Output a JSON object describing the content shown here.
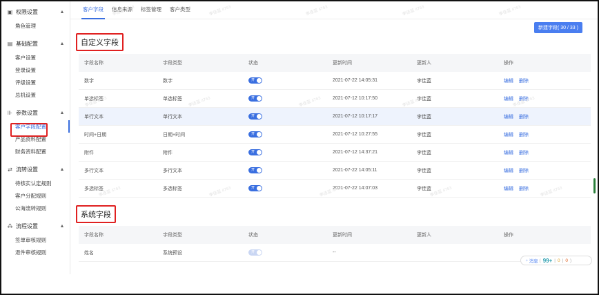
{
  "sidebar": {
    "groups": [
      {
        "icon": "shield-icon",
        "label": "权限设置",
        "items": [
          "角色管理"
        ]
      },
      {
        "icon": "doc-icon",
        "label": "基础配置",
        "items": [
          "客户设置",
          "登录设置",
          "评级设置",
          "总机设置"
        ]
      },
      {
        "icon": "sliders-icon",
        "label": "参数设置",
        "items": [
          "客户字段配置",
          "产品资料配置",
          "财务资料配置"
        ]
      },
      {
        "icon": "flow-icon",
        "label": "流转设置",
        "items": [
          "待核实认定规则",
          "客户分配规则",
          "公海流转规则"
        ]
      },
      {
        "icon": "process-icon",
        "label": "流程设置",
        "items": [
          "签单审核规则",
          "退件审核规则"
        ]
      }
    ]
  },
  "tabs": [
    "客户字段",
    "信息来源",
    "标签管理",
    "客户类型"
  ],
  "new_button": "新建字段( 30 / 33 )",
  "custom_section": {
    "title": "自定义字段",
    "headers": [
      "字段名称",
      "字段类型",
      "状态",
      "更新时间",
      "更新人",
      "操作"
    ],
    "rows": [
      {
        "name": "数字",
        "type": "数字",
        "status": "开",
        "time": "2021-07-22 14:05:31",
        "user": "李佳蓝"
      },
      {
        "name": "单选标签",
        "type": "单选标签",
        "status": "开",
        "time": "2021-07-12 10:17:50",
        "user": "李佳蓝"
      },
      {
        "name": "单行文本",
        "type": "单行文本",
        "status": "开",
        "time": "2021-07-12 10:17:17",
        "user": "李佳蓝"
      },
      {
        "name": "时间+日期",
        "type": "日期+时间",
        "status": "开",
        "time": "2021-07-12 10:27:55",
        "user": "李佳蓝"
      },
      {
        "name": "附件",
        "type": "附件",
        "status": "开",
        "time": "2021-07-12 14:37:21",
        "user": "李佳蓝"
      },
      {
        "name": "多行文本",
        "type": "多行文本",
        "status": "开",
        "time": "2021-07-22 14:05:11",
        "user": "李佳蓝"
      },
      {
        "name": "多选标签",
        "type": "多选标签",
        "status": "开",
        "time": "2021-07-22 14:07:03",
        "user": "李佳蓝"
      }
    ],
    "ops": [
      "编辑",
      "删除"
    ]
  },
  "system_section": {
    "title": "系统字段",
    "headers": [
      "字段名称",
      "字段类型",
      "状态",
      "更新时间",
      "更新人",
      "操作"
    ],
    "rows": [
      {
        "name": "姓名",
        "type": "系统预设",
        "status": "开",
        "time": "--",
        "user": ""
      }
    ]
  },
  "messages": {
    "label": "消息",
    "count": "99+",
    "count2": "0",
    "count3": "0"
  },
  "watermark": "李佳蓝 4763",
  "colors": {
    "accent": "#3a6fe0",
    "highlight": "#e02020"
  }
}
